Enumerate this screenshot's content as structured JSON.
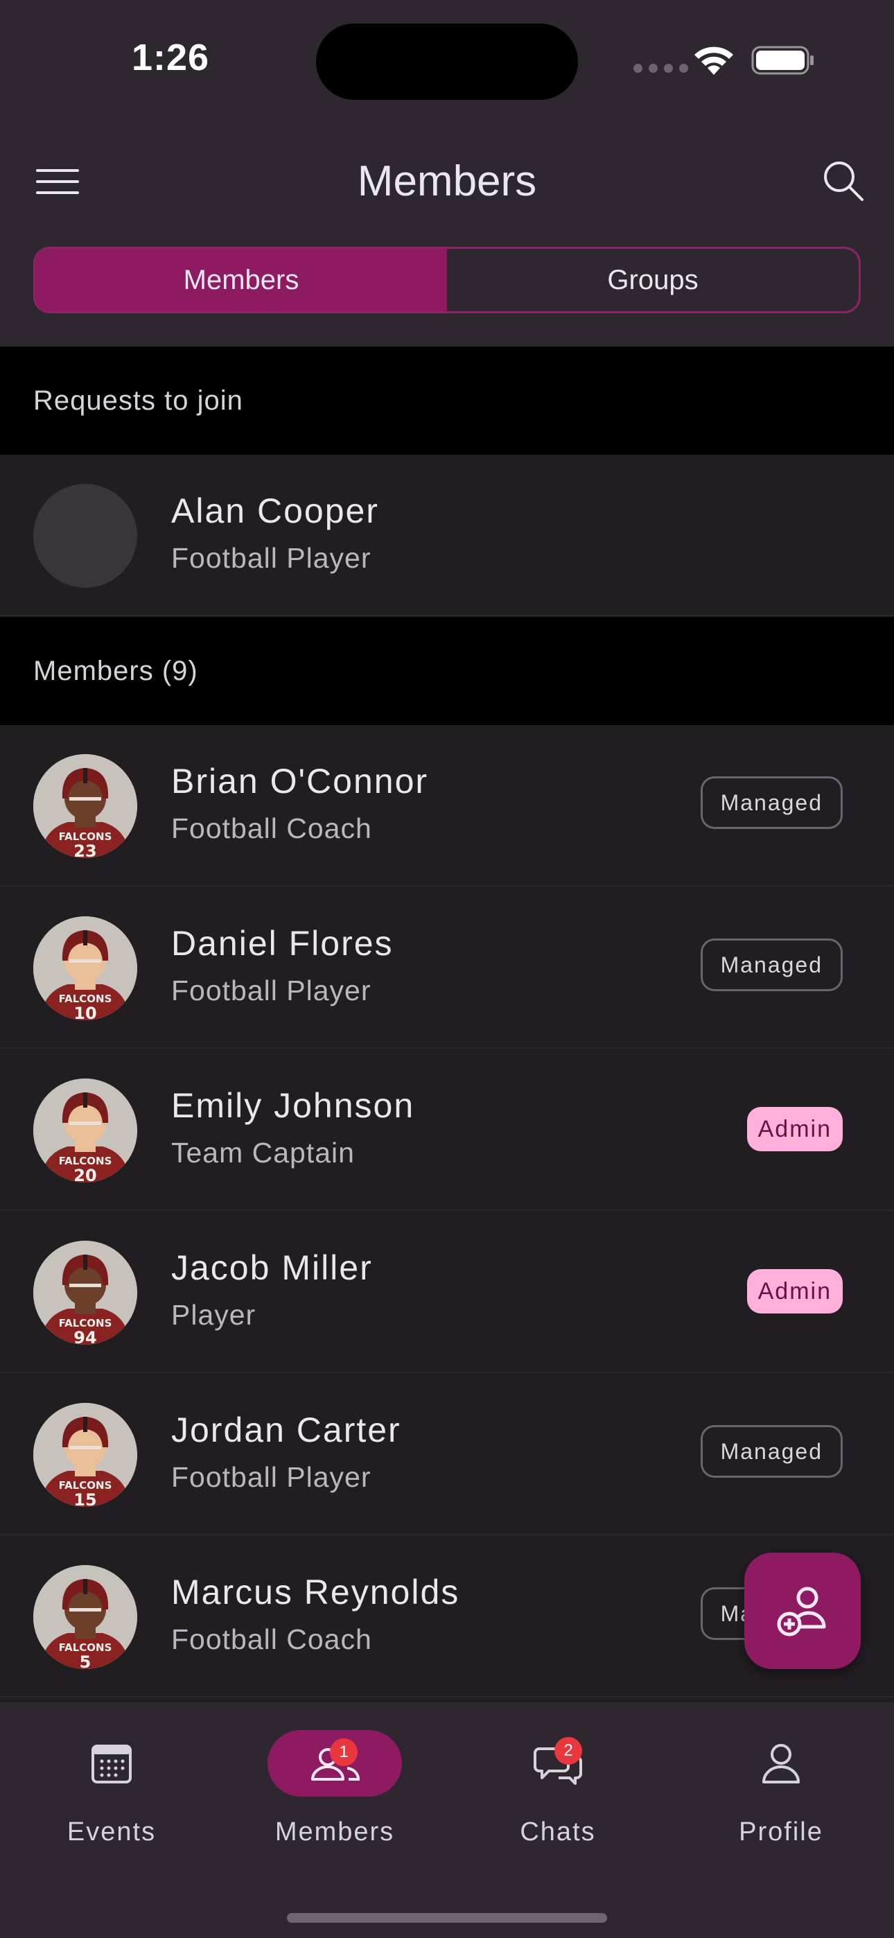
{
  "status_bar": {
    "time": "1:26"
  },
  "header": {
    "title": "Members"
  },
  "segmented": {
    "members_label": "Members",
    "groups_label": "Groups",
    "selected": "Members"
  },
  "requests": {
    "heading": "Requests to join",
    "items": [
      {
        "name": "Alan Cooper",
        "role": "Football Player"
      }
    ]
  },
  "members": {
    "heading": "Members (9)",
    "items": [
      {
        "name": "Brian O'Connor",
        "role": "Football Coach",
        "badge": "Managed",
        "badge_type": "managed",
        "skin": "#6b3f2a",
        "number": "23"
      },
      {
        "name": "Daniel Flores",
        "role": "Football Player",
        "badge": "Managed",
        "badge_type": "managed",
        "skin": "#e8bf97",
        "number": "10"
      },
      {
        "name": "Emily Johnson",
        "role": "Team Captain",
        "badge": "Admin",
        "badge_type": "admin",
        "skin": "#e8bf97",
        "number": "20"
      },
      {
        "name": "Jacob Miller",
        "role": "Player",
        "badge": "Admin",
        "badge_type": "admin",
        "skin": "#6b3f2a",
        "number": "94"
      },
      {
        "name": "Jordan Carter",
        "role": "Football Player",
        "badge": "Managed",
        "badge_type": "managed",
        "skin": "#e8bf97",
        "number": "15"
      },
      {
        "name": "Marcus Reynolds",
        "role": "Football Coach",
        "badge": "Managed",
        "badge_type": "managed",
        "skin": "#6b3f2a",
        "number": "5"
      }
    ]
  },
  "avatar_text": "FALCONS",
  "nav": {
    "items": [
      {
        "label": "Events",
        "count": ""
      },
      {
        "label": "Members",
        "count": "1"
      },
      {
        "label": "Chats",
        "count": "2"
      },
      {
        "label": "Profile",
        "count": ""
      }
    ],
    "selected": "Members"
  },
  "colors": {
    "accent": "#8e1b62",
    "admin_badge": "#ffb1dc",
    "notification": "#e8383d",
    "background": "#211e22",
    "header": "#2e2730"
  }
}
